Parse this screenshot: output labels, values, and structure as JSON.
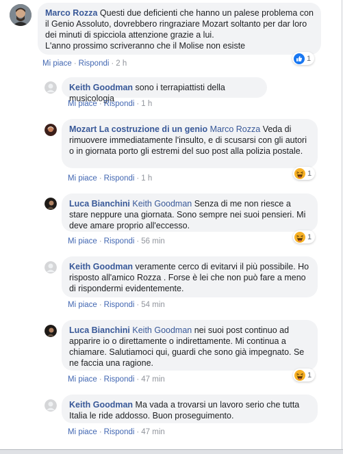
{
  "colors": {
    "link": "#385898",
    "action_link": "#4267b2",
    "meta": "#90949c",
    "bubble_bg": "#f2f3f5",
    "like_blue": "#1877f2",
    "haha_yellow": "#f7b125"
  },
  "actions": {
    "like": "Mi piace",
    "reply": "Rispondi",
    "sep": "·"
  },
  "comments": [
    {
      "author": "Marco Rozza",
      "mention": "",
      "text": "Questi due deficienti che hanno un palese problema con il Genio Assoluto, dovrebbero ringraziare Mozart soltanto per dar loro dei minuti di spicciola attenzione grazie a lui.\nL'anno prossimo scriveranno che il Molise non esiste",
      "time": "2 h",
      "reaction": {
        "icon": "like-icon",
        "count": "1"
      }
    },
    {
      "author": "Keith Goodman",
      "mention": "",
      "text": "sono i terrapiattisti della musicologia",
      "time": "1 h"
    },
    {
      "author": "Mozart La costruzione di un genio",
      "mention": "Marco Rozza",
      "text": "Veda di rimuovere immediatamente l'insulto, e di scusarsi con gli autori o in giornata porto gli estremi del suo post alla polizia postale.",
      "time": "1 h",
      "reaction": {
        "icon": "haha-icon",
        "count": "1"
      }
    },
    {
      "author": "Luca Bianchini",
      "mention": "Keith Goodman",
      "text": "Senza di me non riesce a stare neppure una giornata. Sono sempre nei suoi pensieri. Mi deve amare proprio all'eccesso.",
      "time": "56 min",
      "reaction": {
        "icon": "haha-icon",
        "count": "1"
      }
    },
    {
      "author": "Keith Goodman",
      "mention": "",
      "text": "veramente cerco di evitarvi il più possibile. Ho risposto all'amico Rozza . Forse è lei che non può fare a meno di rispondermi evidentemente.",
      "time": "54 min"
    },
    {
      "author": "Luca Bianchini",
      "mention": "Keith Goodman",
      "text": "nei suoi post continuo ad apparire io o direttamente o indirettamente. Mi continua a chiamare. Salutiamoci qui, guardi che sono già impegnato. Se ne faccia una ragione.",
      "time": "47 min",
      "reaction": {
        "icon": "haha-icon",
        "count": "1"
      }
    },
    {
      "author": "Keith Goodman",
      "mention": "",
      "text": "Ma vada a trovarsi un lavoro serio che tutta Italia le ride addosso. Buon proseguimento.",
      "time": "47 min"
    }
  ]
}
